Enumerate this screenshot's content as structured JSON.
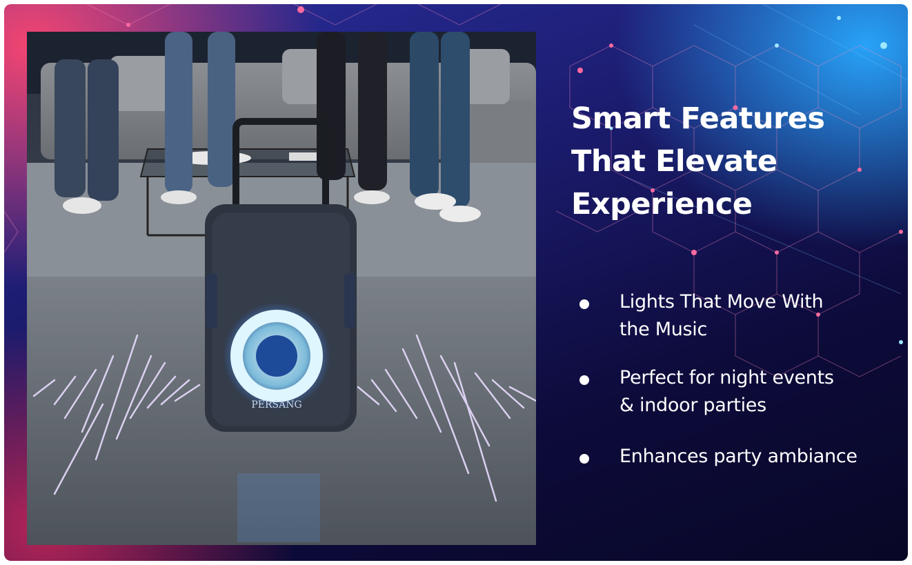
{
  "headline": {
    "line1": "Smart Features",
    "line2": "That Elevate",
    "line3": "Experience"
  },
  "features": [
    {
      "line1": "Lights That Move With",
      "line2": "the Music"
    },
    {
      "line1": "Perfect for night events",
      "line2": "& indoor parties"
    },
    {
      "line1": "Enhances party ambiance"
    }
  ],
  "product": {
    "brand_label": "PERSANG"
  },
  "colors": {
    "accent_pink": "#ff4a78",
    "accent_cyan": "#2ab0ff",
    "glow_blue": "#7fd8ff",
    "wave_purple": "#c9a6ff"
  }
}
